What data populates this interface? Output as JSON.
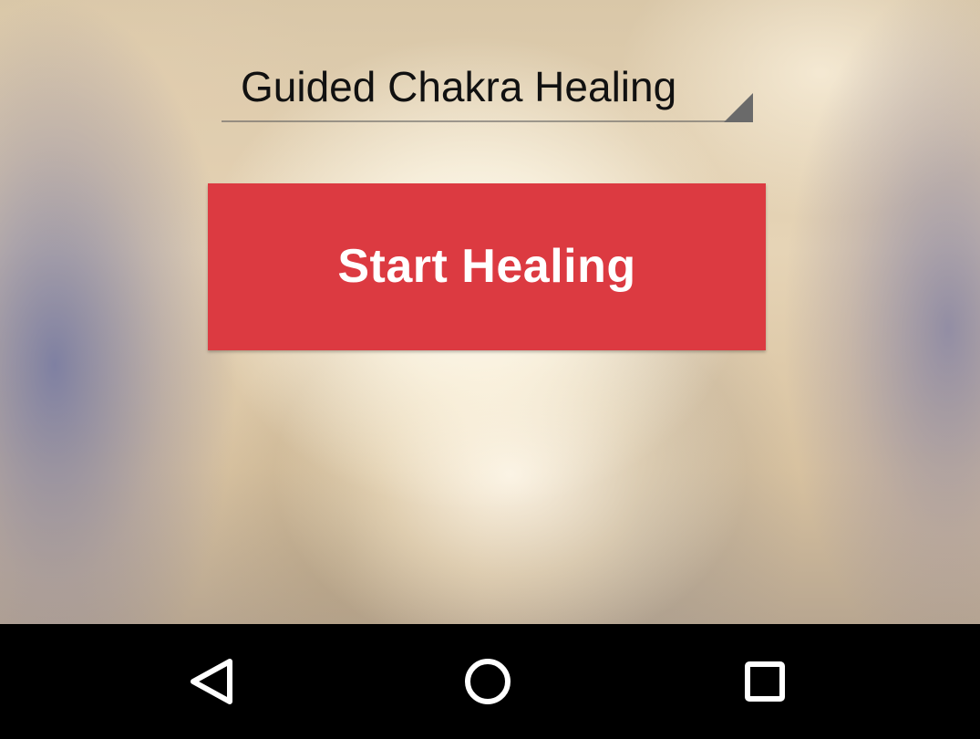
{
  "spinner": {
    "selected_value": "Guided Chakra Healing"
  },
  "start_button": {
    "label": "Start Healing",
    "color": "#dc3a41"
  },
  "nav_bar": {
    "back_icon": "back-triangle-icon",
    "home_icon": "home-circle-icon",
    "recents_icon": "recents-square-icon"
  }
}
